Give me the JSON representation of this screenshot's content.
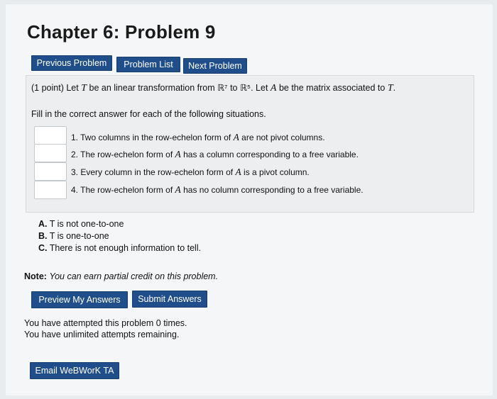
{
  "title": "Chapter 6: Problem 9",
  "nav": {
    "previous": "Previous Problem",
    "list": "Problem List",
    "next": "Next Problem"
  },
  "problem": {
    "points": "(1 point)",
    "intro_pre": "Let",
    "T": "T",
    "intro_mid": "be an linear transformation from",
    "domain": "ℝ⁷",
    "to": "to",
    "codomain": "ℝ⁵",
    "intro_post": ". Let",
    "A": "A",
    "intro_post2": "be the matrix associated to",
    "end": ".",
    "fill_text": "Fill in the correct answer for each of the following situations.",
    "items": [
      {
        "pre": "1. Two columns in the row-echelon form of",
        "post": "are not pivot columns."
      },
      {
        "pre": "2. The row-echelon form of",
        "post": "has a column corresponding to a free variable."
      },
      {
        "pre": "3. Every column in the row-echelon form of",
        "post": "is a pivot column."
      },
      {
        "pre": "4. The row-echelon form of",
        "post": "has no column corresponding to a free variable."
      }
    ],
    "options": [
      {
        "letter": "A.",
        "text": "T is not one-to-one"
      },
      {
        "letter": "B.",
        "text": "T is one-to-one"
      },
      {
        "letter": "C.",
        "text": "There is not enough information to tell."
      }
    ]
  },
  "note": {
    "label": "Note:",
    "text": "You can earn partial credit on this problem."
  },
  "actions": {
    "preview": "Preview My Answers",
    "submit": "Submit Answers"
  },
  "attempts": {
    "line1": "You have attempted this problem 0 times.",
    "line2": "You have unlimited attempts remaining."
  },
  "email": "Email WeBWorK TA"
}
